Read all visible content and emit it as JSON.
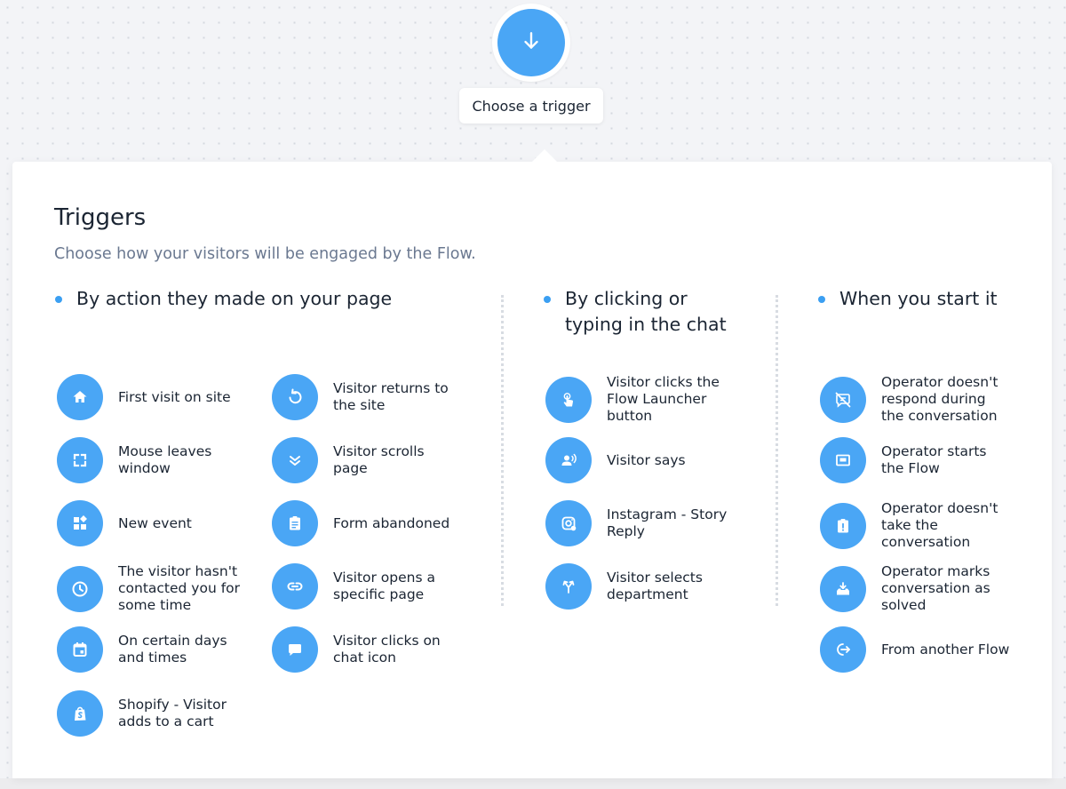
{
  "header": {
    "trigger_icon": "arrow-down-icon",
    "trigger_label": "Choose a trigger"
  },
  "panel": {
    "title": "Triggers",
    "subtitle": "Choose how your visitors will be engaged by the Flow."
  },
  "sections": {
    "page_actions": {
      "heading": "By action they made on your page",
      "items": [
        {
          "label": "First visit on site",
          "icon": "home-icon"
        },
        {
          "label": "Visitor returns to\nthe site",
          "icon": "return-arrow-icon"
        },
        {
          "label": "Mouse leaves\nwindow",
          "icon": "fullscreen-icon"
        },
        {
          "label": "Visitor scrolls\npage",
          "icon": "double-chevron-down-icon"
        },
        {
          "label": "New event",
          "icon": "widgets-icon"
        },
        {
          "label": "Form abandoned",
          "icon": "clipboard-icon"
        },
        {
          "label": "The visitor hasn't\ncontacted you for\nsome time",
          "icon": "clock-icon"
        },
        {
          "label": "Visitor opens a\nspecific page",
          "icon": "link-icon"
        },
        {
          "label": "On certain days\nand times",
          "icon": "calendar-icon"
        },
        {
          "label": "Visitor clicks on\nchat icon",
          "icon": "chat-bubble-icon"
        },
        {
          "label": "Shopify - Visitor\nadds to a cart",
          "icon": "shopify-bag-icon"
        }
      ]
    },
    "chat_actions": {
      "heading": "By clicking or\ntyping in the chat",
      "items": [
        {
          "label": "Visitor clicks the\nFlow Launcher\nbutton",
          "icon": "touch-icon"
        },
        {
          "label": "Visitor says",
          "icon": "speaking-person-icon"
        },
        {
          "label": "Instagram - Story\nReply",
          "icon": "instagram-icon"
        },
        {
          "label": "Visitor selects\ndepartment",
          "icon": "merge-arrows-icon"
        }
      ]
    },
    "operator_actions": {
      "heading": "When you start it",
      "items": [
        {
          "label": "Operator doesn't\nrespond during\nthe conversation",
          "icon": "chat-off-icon"
        },
        {
          "label": "Operator starts\nthe Flow",
          "icon": "window-icon"
        },
        {
          "label": "Operator doesn't\ntake the\nconversation",
          "icon": "alert-clipboard-icon"
        },
        {
          "label": "Operator marks\nconversation as\nsolved",
          "icon": "tray-download-icon"
        },
        {
          "label": "From another Flow",
          "icon": "exit-arrow-icon"
        }
      ]
    }
  },
  "colors": {
    "accent": "#4aa6f5",
    "bullet": "#3b9ff2",
    "subtitle": "#6a7890",
    "text": "#1b2533"
  }
}
